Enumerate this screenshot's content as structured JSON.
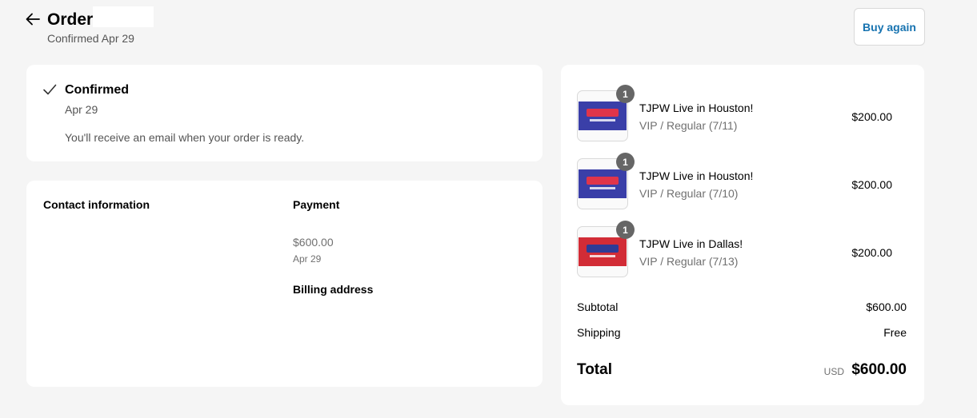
{
  "header": {
    "title": "Order",
    "subtitle": "Confirmed Apr 29",
    "buy_again_label": "Buy again"
  },
  "status": {
    "title": "Confirmed",
    "date": "Apr 29",
    "message": "You'll receive an email when your order is ready."
  },
  "info": {
    "contact_heading": "Contact information",
    "payment_heading": "Payment",
    "payment_amount": "$600.00",
    "payment_date": "Apr 29",
    "billing_heading": "Billing address"
  },
  "items": [
    {
      "quantity": "1",
      "title": "TJPW Live in Houston!",
      "variant": "VIP / Regular (7/11)",
      "price": "$200.00",
      "thumb_color": "#3a3fa8",
      "thumb_accent": "#e0354a"
    },
    {
      "quantity": "1",
      "title": "TJPW Live in Houston!",
      "variant": "VIP / Regular (7/10)",
      "price": "$200.00",
      "thumb_color": "#3a3fa8",
      "thumb_accent": "#e0354a"
    },
    {
      "quantity": "1",
      "title": "TJPW Live in Dallas!",
      "variant": "VIP / Regular (7/13)",
      "price": "$200.00",
      "thumb_color": "#d22c36",
      "thumb_accent": "#2d3b96"
    }
  ],
  "summary": {
    "subtotal_label": "Subtotal",
    "subtotal_value": "$600.00",
    "shipping_label": "Shipping",
    "shipping_value": "Free",
    "total_label": "Total",
    "currency": "USD",
    "total_value": "$600.00"
  },
  "colors": {
    "background": "#f5f5f5",
    "card": "#ffffff",
    "accent_link": "#1773b0",
    "muted_text": "#707070",
    "badge": "#666666"
  },
  "icons": {
    "back": "arrow-left-icon",
    "status": "checkmark-icon"
  }
}
